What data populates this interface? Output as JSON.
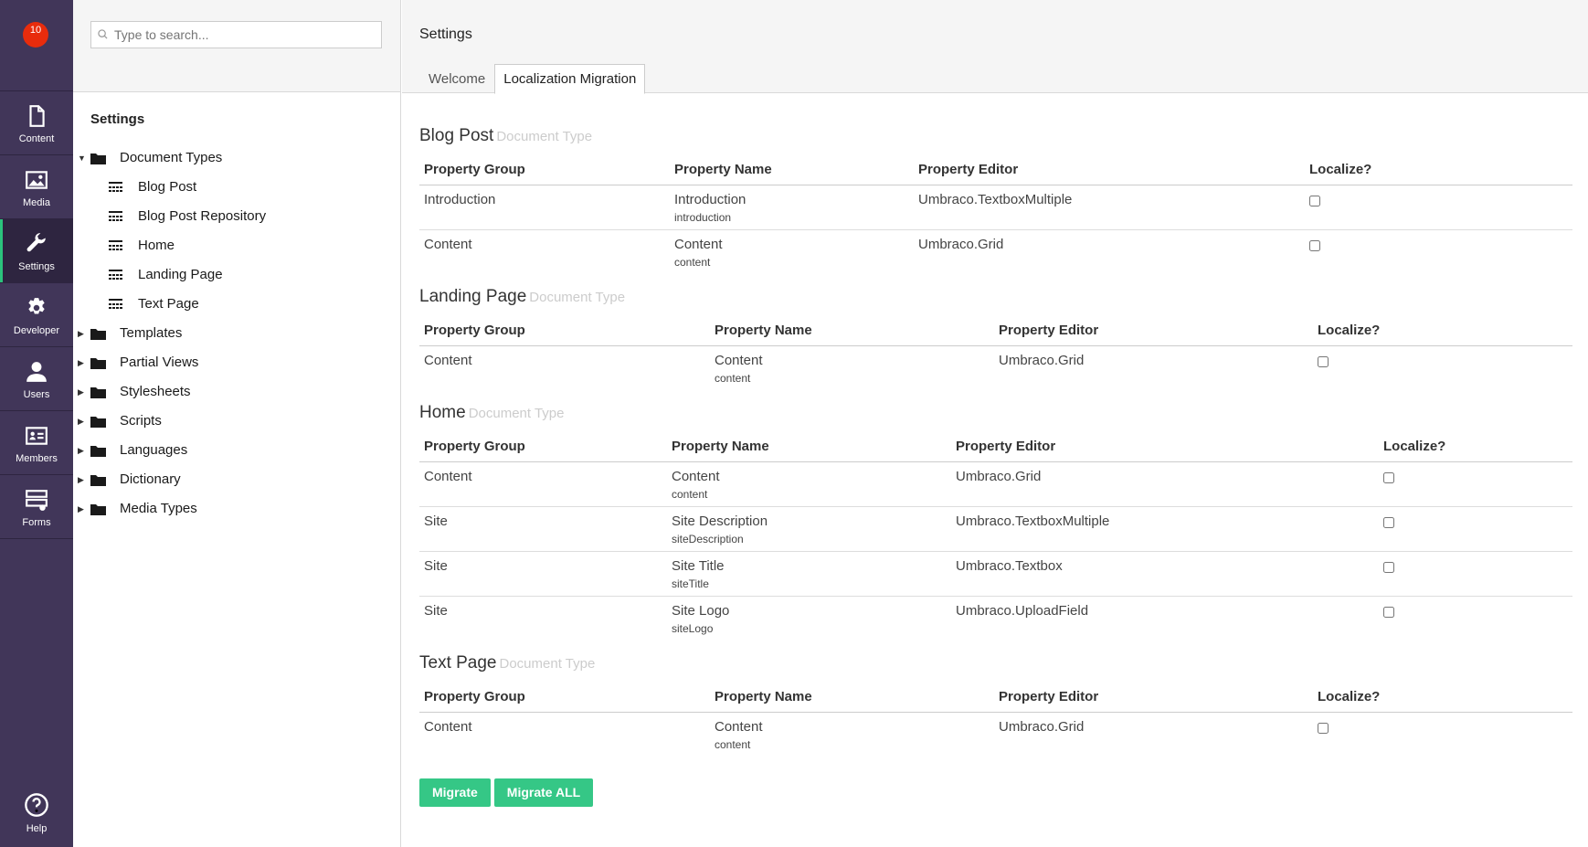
{
  "appbar": {
    "notifications_count": "10",
    "items": [
      {
        "label": "Content",
        "icon": "document-icon"
      },
      {
        "label": "Media",
        "icon": "image-icon"
      },
      {
        "label": "Settings",
        "icon": "wrench-icon"
      },
      {
        "label": "Developer",
        "icon": "gear-icon"
      },
      {
        "label": "Users",
        "icon": "user-icon"
      },
      {
        "label": "Members",
        "icon": "id-card-icon"
      },
      {
        "label": "Forms",
        "icon": "forms-icon"
      }
    ],
    "help_label": "Help"
  },
  "tree": {
    "search_placeholder": "Type to search...",
    "title": "Settings",
    "document_types": {
      "label": "Document Types",
      "children": [
        "Blog Post",
        "Blog Post Repository",
        "Home",
        "Landing Page",
        "Text Page"
      ]
    },
    "folders": [
      "Templates",
      "Partial Views",
      "Stylesheets",
      "Scripts",
      "Languages",
      "Dictionary",
      "Media Types"
    ]
  },
  "main": {
    "title": "Settings",
    "tabs": [
      {
        "label": "Welcome",
        "active": false
      },
      {
        "label": "Localization Migration",
        "active": true
      }
    ],
    "columns": {
      "group": "Property Group",
      "name": "Property Name",
      "editor": "Property Editor",
      "localize": "Localize?"
    },
    "document_type_suffix": "Document Type",
    "sections": [
      {
        "title": "Blog Post",
        "rows": [
          {
            "group": "Introduction",
            "name": "Introduction",
            "alias": "introduction",
            "editor": "Umbraco.TextboxMultiple"
          },
          {
            "group": "Content",
            "name": "Content",
            "alias": "content",
            "editor": "Umbraco.Grid"
          }
        ]
      },
      {
        "title": "Landing Page",
        "rows": [
          {
            "group": "Content",
            "name": "Content",
            "alias": "content",
            "editor": "Umbraco.Grid"
          }
        ]
      },
      {
        "title": "Home",
        "rows": [
          {
            "group": "Content",
            "name": "Content",
            "alias": "content",
            "editor": "Umbraco.Grid"
          },
          {
            "group": "Site",
            "name": "Site Description",
            "alias": "siteDescription",
            "editor": "Umbraco.TextboxMultiple"
          },
          {
            "group": "Site",
            "name": "Site Title",
            "alias": "siteTitle",
            "editor": "Umbraco.Textbox"
          },
          {
            "group": "Site",
            "name": "Site Logo",
            "alias": "siteLogo",
            "editor": "Umbraco.UploadField"
          }
        ]
      },
      {
        "title": "Text Page",
        "rows": [
          {
            "group": "Content",
            "name": "Content",
            "alias": "content",
            "editor": "Umbraco.Grid"
          }
        ]
      }
    ],
    "buttons": {
      "migrate": "Migrate",
      "migrate_all": "Migrate ALL"
    }
  },
  "colors": {
    "appbar_bg": "#413659",
    "accent_green": "#35c786",
    "badge_red": "#e82c0c"
  }
}
